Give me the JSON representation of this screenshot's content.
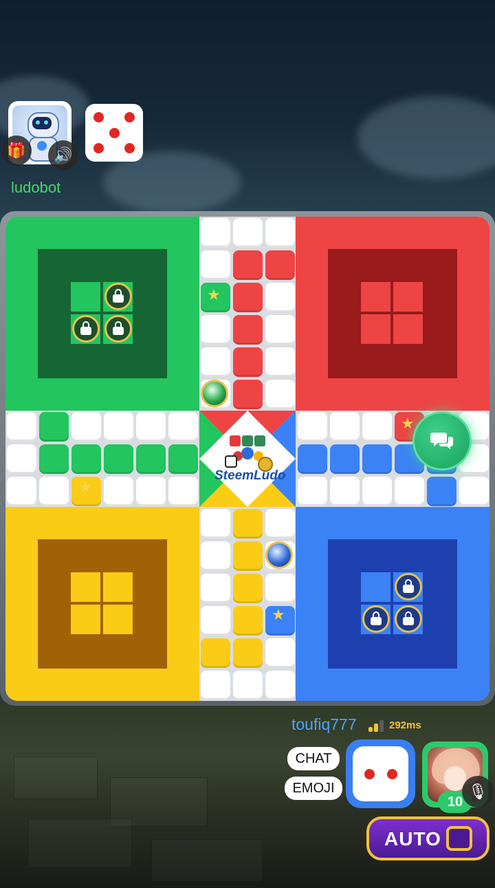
{
  "opponent": {
    "name": "ludobot",
    "avatar_icon": "robot-icon",
    "gift_icon": "gift-icon",
    "sound_icon": "speaker-icon",
    "dice_value": 5
  },
  "board": {
    "colors": {
      "green": "#22c55e",
      "red": "#ef4444",
      "yellow": "#facc15",
      "blue": "#3b82f6"
    },
    "logo_text": "SteemLudo",
    "locked_tokens": {
      "green": 3,
      "blue": 3
    },
    "tokens_on_track": [
      "green",
      "blue"
    ]
  },
  "chat_fab": {
    "icon": "chat-bubbles-icon"
  },
  "player": {
    "name": "toufiq777",
    "ping": "292ms",
    "chat_label": "CHAT",
    "emoji_label": "EMOJI",
    "dice_value": 2,
    "level": "10",
    "mic_icon": "microphone-icon",
    "auto_label": "AUTO",
    "auto_enabled": false
  }
}
